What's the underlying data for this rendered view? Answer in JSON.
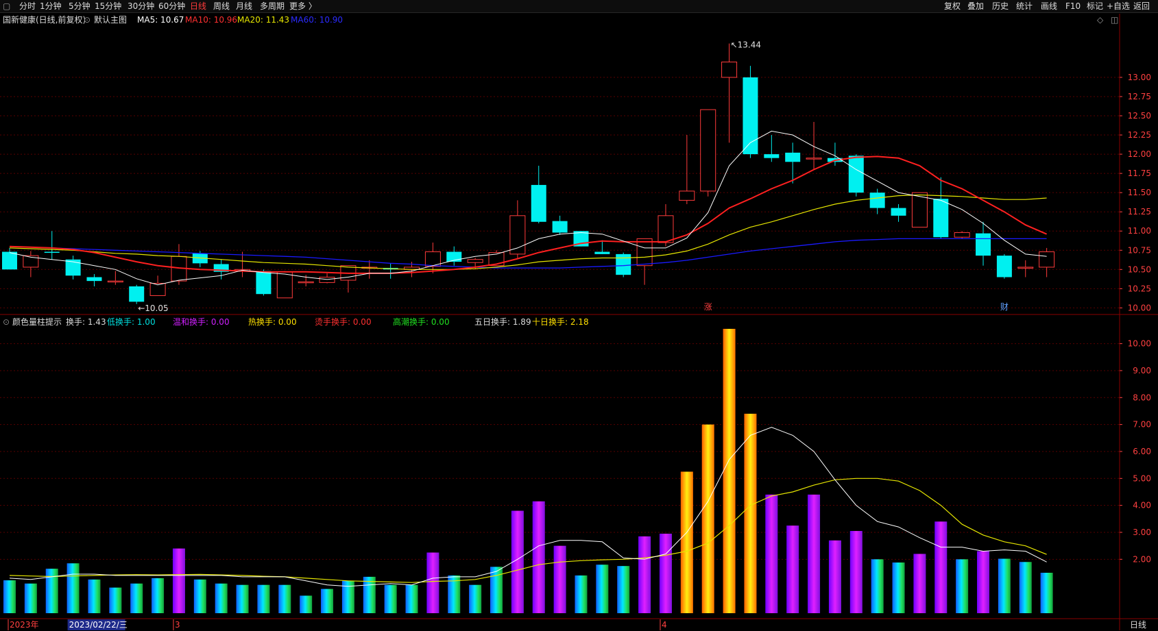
{
  "toolbar": {
    "left_items": [
      "分时",
      "1分钟",
      "5分钟",
      "15分钟",
      "30分钟",
      "60分钟",
      "日线",
      "周线",
      "月线",
      "多周期",
      "更多 〉"
    ],
    "active": "日线",
    "right_items": [
      "复权",
      "叠加",
      "历史",
      "统计",
      "画线",
      "F10",
      "标记",
      "+自选",
      "返回"
    ]
  },
  "main_info": {
    "stock": "国新健康(日线,前复权)",
    "template": "默认主图",
    "ma5": "MA5: 10.67",
    "ma10": "MA10: 10.96",
    "ma20": "MA20: 11.43",
    "ma60": "MA60: 10.90"
  },
  "sub_info": {
    "indicator": "颜色量柱提示",
    "turnover": "换手: 1.43",
    "low": "低换手: 1.00",
    "mild": "温和换手: 0.00",
    "hot": "热换手: 0.00",
    "burning": "烫手换手: 0.00",
    "climax": "高潮换手: 0.00",
    "day5": "五日换手: 1.89",
    "day10": "十日换手: 2.18"
  },
  "colors": {
    "up": "#ff3b3b",
    "down": "#00f0f0",
    "ma5": "#ffffff",
    "ma10": "#ff2020",
    "ma20": "#e6e600",
    "ma60": "#1a1aff",
    "grid": "#5a0000",
    "axis": "#ff4040"
  },
  "chart_data": [
    {
      "type": "candlestick",
      "title": "国新健康(日线,前复权)",
      "ylim": [
        9.95,
        13.65
      ],
      "yticks": [
        "10.00",
        "10.25",
        "10.50",
        "10.75",
        "11.00",
        "11.25",
        "11.50",
        "11.75",
        "12.00",
        "12.25",
        "12.50",
        "12.75",
        "13.00"
      ],
      "high_label": "13.44",
      "low_label": "10.05",
      "markers": [
        {
          "text": "涨",
          "index": 33
        },
        {
          "text": "财",
          "index": 47
        }
      ],
      "candles": [
        {
          "o": 10.73,
          "h": 10.78,
          "l": 10.5,
          "c": 10.5
        },
        {
          "o": 10.53,
          "h": 10.74,
          "l": 10.4,
          "c": 10.68
        },
        {
          "o": 10.73,
          "h": 11.0,
          "l": 10.63,
          "c": 10.72
        },
        {
          "o": 10.63,
          "h": 10.68,
          "l": 10.37,
          "c": 10.42
        },
        {
          "o": 10.4,
          "h": 10.44,
          "l": 10.28,
          "c": 10.35
        },
        {
          "o": 10.35,
          "h": 10.48,
          "l": 10.3,
          "c": 10.35
        },
        {
          "o": 10.28,
          "h": 10.3,
          "l": 10.05,
          "c": 10.08
        },
        {
          "o": 10.16,
          "h": 10.42,
          "l": 10.16,
          "c": 10.32
        },
        {
          "o": 10.35,
          "h": 10.83,
          "l": 10.3,
          "c": 10.67
        },
        {
          "o": 10.71,
          "h": 10.74,
          "l": 10.53,
          "c": 10.58
        },
        {
          "o": 10.57,
          "h": 10.63,
          "l": 10.37,
          "c": 10.47
        },
        {
          "o": 10.48,
          "h": 10.73,
          "l": 10.4,
          "c": 10.5
        },
        {
          "o": 10.48,
          "h": 10.5,
          "l": 10.16,
          "c": 10.18
        },
        {
          "o": 10.13,
          "h": 10.48,
          "l": 10.13,
          "c": 10.47
        },
        {
          "o": 10.34,
          "h": 10.43,
          "l": 10.28,
          "c": 10.34
        },
        {
          "o": 10.33,
          "h": 10.45,
          "l": 10.32,
          "c": 10.4
        },
        {
          "o": 10.36,
          "h": 10.55,
          "l": 10.2,
          "c": 10.55
        },
        {
          "o": 10.52,
          "h": 10.62,
          "l": 10.38,
          "c": 10.53
        },
        {
          "o": 10.52,
          "h": 10.58,
          "l": 10.38,
          "c": 10.5
        },
        {
          "o": 10.5,
          "h": 10.6,
          "l": 10.4,
          "c": 10.53
        },
        {
          "o": 10.54,
          "h": 10.85,
          "l": 10.45,
          "c": 10.73
        },
        {
          "o": 10.73,
          "h": 10.8,
          "l": 10.55,
          "c": 10.6
        },
        {
          "o": 10.59,
          "h": 10.65,
          "l": 10.5,
          "c": 10.63
        },
        {
          "o": 10.55,
          "h": 10.75,
          "l": 10.55,
          "c": 10.72
        },
        {
          "o": 10.7,
          "h": 11.4,
          "l": 10.65,
          "c": 11.2
        },
        {
          "o": 11.6,
          "h": 11.85,
          "l": 11.1,
          "c": 11.12
        },
        {
          "o": 11.13,
          "h": 11.2,
          "l": 10.95,
          "c": 10.98
        },
        {
          "o": 11.0,
          "h": 11.0,
          "l": 10.8,
          "c": 10.8
        },
        {
          "o": 10.73,
          "h": 10.88,
          "l": 10.7,
          "c": 10.7
        },
        {
          "o": 10.7,
          "h": 10.72,
          "l": 10.4,
          "c": 10.43
        },
        {
          "o": 10.55,
          "h": 10.9,
          "l": 10.3,
          "c": 10.9
        },
        {
          "o": 10.85,
          "h": 11.35,
          "l": 10.8,
          "c": 11.2
        },
        {
          "o": 11.4,
          "h": 12.25,
          "l": 11.35,
          "c": 11.52
        },
        {
          "o": 11.52,
          "h": 12.58,
          "l": 11.45,
          "c": 12.58
        },
        {
          "o": 13.0,
          "h": 13.44,
          "l": 12.15,
          "c": 13.2
        },
        {
          "o": 13.0,
          "h": 13.15,
          "l": 11.95,
          "c": 12.0
        },
        {
          "o": 12.0,
          "h": 12.25,
          "l": 11.9,
          "c": 11.95
        },
        {
          "o": 12.02,
          "h": 12.15,
          "l": 11.62,
          "c": 11.9
        },
        {
          "o": 11.95,
          "h": 12.42,
          "l": 11.8,
          "c": 11.95
        },
        {
          "o": 11.95,
          "h": 12.15,
          "l": 11.85,
          "c": 11.9
        },
        {
          "o": 11.98,
          "h": 12.0,
          "l": 11.45,
          "c": 11.5
        },
        {
          "o": 11.5,
          "h": 11.55,
          "l": 11.22,
          "c": 11.3
        },
        {
          "o": 11.3,
          "h": 11.35,
          "l": 11.12,
          "c": 11.2
        },
        {
          "o": 11.05,
          "h": 11.5,
          "l": 11.05,
          "c": 11.5
        },
        {
          "o": 11.42,
          "h": 11.7,
          "l": 10.9,
          "c": 10.92
        },
        {
          "o": 10.92,
          "h": 11.0,
          "l": 10.9,
          "c": 10.98
        },
        {
          "o": 10.97,
          "h": 11.12,
          "l": 10.55,
          "c": 10.68
        },
        {
          "o": 10.68,
          "h": 10.7,
          "l": 10.38,
          "c": 10.4
        },
        {
          "o": 10.52,
          "h": 10.62,
          "l": 10.4,
          "c": 10.53
        },
        {
          "o": 10.53,
          "h": 10.78,
          "l": 10.4,
          "c": 10.73
        }
      ],
      "ma5": [
        10.72,
        10.66,
        10.63,
        10.6,
        10.55,
        10.5,
        10.38,
        10.3,
        10.36,
        10.39,
        10.42,
        10.49,
        10.46,
        10.44,
        10.4,
        10.37,
        10.4,
        10.45,
        10.45,
        10.48,
        10.55,
        10.62,
        10.67,
        10.7,
        10.78,
        10.9,
        10.96,
        10.98,
        10.96,
        10.87,
        10.78,
        10.78,
        10.91,
        11.24,
        11.85,
        12.15,
        12.3,
        12.25,
        12.1,
        11.98,
        11.8,
        11.65,
        11.5,
        11.45,
        11.4,
        11.28,
        11.1,
        10.88,
        10.7,
        10.67
      ],
      "ma10": [
        10.8,
        10.79,
        10.78,
        10.76,
        10.72,
        10.66,
        10.6,
        10.55,
        10.52,
        10.5,
        10.49,
        10.48,
        10.47,
        10.47,
        10.47,
        10.46,
        10.45,
        10.45,
        10.45,
        10.46,
        10.48,
        10.5,
        10.53,
        10.57,
        10.64,
        10.72,
        10.78,
        10.84,
        10.87,
        10.86,
        10.86,
        10.86,
        10.95,
        11.1,
        11.3,
        11.42,
        11.55,
        11.66,
        11.8,
        11.92,
        11.96,
        11.97,
        11.95,
        11.85,
        11.66,
        11.55,
        11.4,
        11.25,
        11.08,
        10.96
      ],
      "ma20": [
        10.78,
        10.77,
        10.76,
        10.75,
        10.73,
        10.71,
        10.7,
        10.68,
        10.67,
        10.65,
        10.63,
        10.61,
        10.59,
        10.58,
        10.57,
        10.55,
        10.53,
        10.52,
        10.51,
        10.5,
        10.5,
        10.5,
        10.51,
        10.53,
        10.56,
        10.6,
        10.62,
        10.64,
        10.65,
        10.65,
        10.66,
        10.69,
        10.74,
        10.83,
        10.95,
        11.05,
        11.12,
        11.2,
        11.28,
        11.35,
        11.4,
        11.43,
        11.46,
        11.47,
        11.46,
        11.45,
        11.43,
        11.41,
        11.41,
        11.43
      ],
      "ma60": [
        10.8,
        10.79,
        10.78,
        10.77,
        10.76,
        10.75,
        10.74,
        10.73,
        10.72,
        10.71,
        10.7,
        10.69,
        10.68,
        10.67,
        10.66,
        10.64,
        10.62,
        10.6,
        10.58,
        10.57,
        10.55,
        10.54,
        10.53,
        10.52,
        10.52,
        10.52,
        10.52,
        10.53,
        10.54,
        10.55,
        10.57,
        10.59,
        10.62,
        10.66,
        10.7,
        10.74,
        10.77,
        10.8,
        10.83,
        10.86,
        10.88,
        10.89,
        10.9,
        10.9,
        10.9,
        10.9,
        10.9,
        10.9,
        10.9,
        10.9
      ]
    },
    {
      "type": "bar",
      "title": "颜色量柱提示",
      "ylim": [
        0.0,
        10.6
      ],
      "yticks": [
        "2.00",
        "3.00",
        "4.00",
        "5.00",
        "6.00",
        "7.00",
        "8.00",
        "9.00",
        "10.00"
      ],
      "values": [
        1.22,
        1.1,
        1.65,
        1.85,
        1.25,
        0.95,
        1.1,
        1.3,
        2.4,
        1.25,
        1.1,
        1.05,
        1.05,
        1.05,
        0.65,
        0.9,
        1.2,
        1.35,
        1.05,
        1.05,
        2.25,
        1.4,
        1.05,
        1.72,
        3.8,
        4.15,
        2.5,
        1.4,
        1.8,
        1.75,
        2.85,
        2.95,
        5.25,
        7.0,
        10.55,
        7.4,
        4.4,
        3.25,
        4.4,
        2.7,
        3.05,
        2.0,
        1.88,
        2.2,
        3.4,
        2.0,
        2.3,
        2.02,
        1.9,
        1.5
      ],
      "categories": [
        "low",
        "low",
        "low",
        "low",
        "low",
        "low",
        "low",
        "low",
        "mild",
        "low",
        "low",
        "low",
        "low",
        "low",
        "low",
        "low",
        "low",
        "low",
        "low",
        "low",
        "mild",
        "low",
        "low",
        "low",
        "mild",
        "mild",
        "mild",
        "low",
        "low",
        "low",
        "mild",
        "mild",
        "hot",
        "hot",
        "hot",
        "hot",
        "mild",
        "mild",
        "mild",
        "mild",
        "mild",
        "low",
        "low",
        "mild",
        "mild",
        "low",
        "mild",
        "low",
        "low",
        "low"
      ],
      "ma5": [
        1.3,
        1.25,
        1.35,
        1.45,
        1.45,
        1.4,
        1.4,
        1.4,
        1.4,
        1.4,
        1.4,
        1.35,
        1.35,
        1.35,
        1.2,
        1.05,
        1.0,
        1.05,
        1.1,
        1.05,
        1.3,
        1.35,
        1.35,
        1.55,
        2.0,
        2.5,
        2.7,
        2.7,
        2.65,
        2.05,
        2.0,
        2.2,
        3.0,
        4.15,
        5.7,
        6.6,
        6.9,
        6.6,
        6.0,
        4.95,
        4.0,
        3.4,
        3.2,
        2.8,
        2.45,
        2.45,
        2.3,
        2.35,
        2.3,
        1.9
      ],
      "ma10": [
        1.4,
        1.38,
        1.36,
        1.38,
        1.4,
        1.42,
        1.43,
        1.42,
        1.43,
        1.44,
        1.42,
        1.4,
        1.37,
        1.35,
        1.3,
        1.25,
        1.2,
        1.18,
        1.16,
        1.14,
        1.18,
        1.2,
        1.25,
        1.4,
        1.6,
        1.8,
        1.9,
        1.95,
        1.98,
        2.0,
        2.05,
        2.15,
        2.3,
        2.6,
        3.25,
        4.0,
        4.35,
        4.5,
        4.75,
        4.95,
        5.0,
        5.0,
        4.9,
        4.55,
        4.0,
        3.3,
        2.9,
        2.65,
        2.5,
        2.18
      ]
    }
  ],
  "bottom_axis": {
    "labels": [
      {
        "text": "2023年",
        "index": 0
      },
      {
        "text": "2023/02/22/三",
        "index": 3,
        "highlight": true
      },
      {
        "text": "3",
        "index": 8
      },
      {
        "text": "4",
        "index": 31
      }
    ],
    "period": "日线"
  }
}
